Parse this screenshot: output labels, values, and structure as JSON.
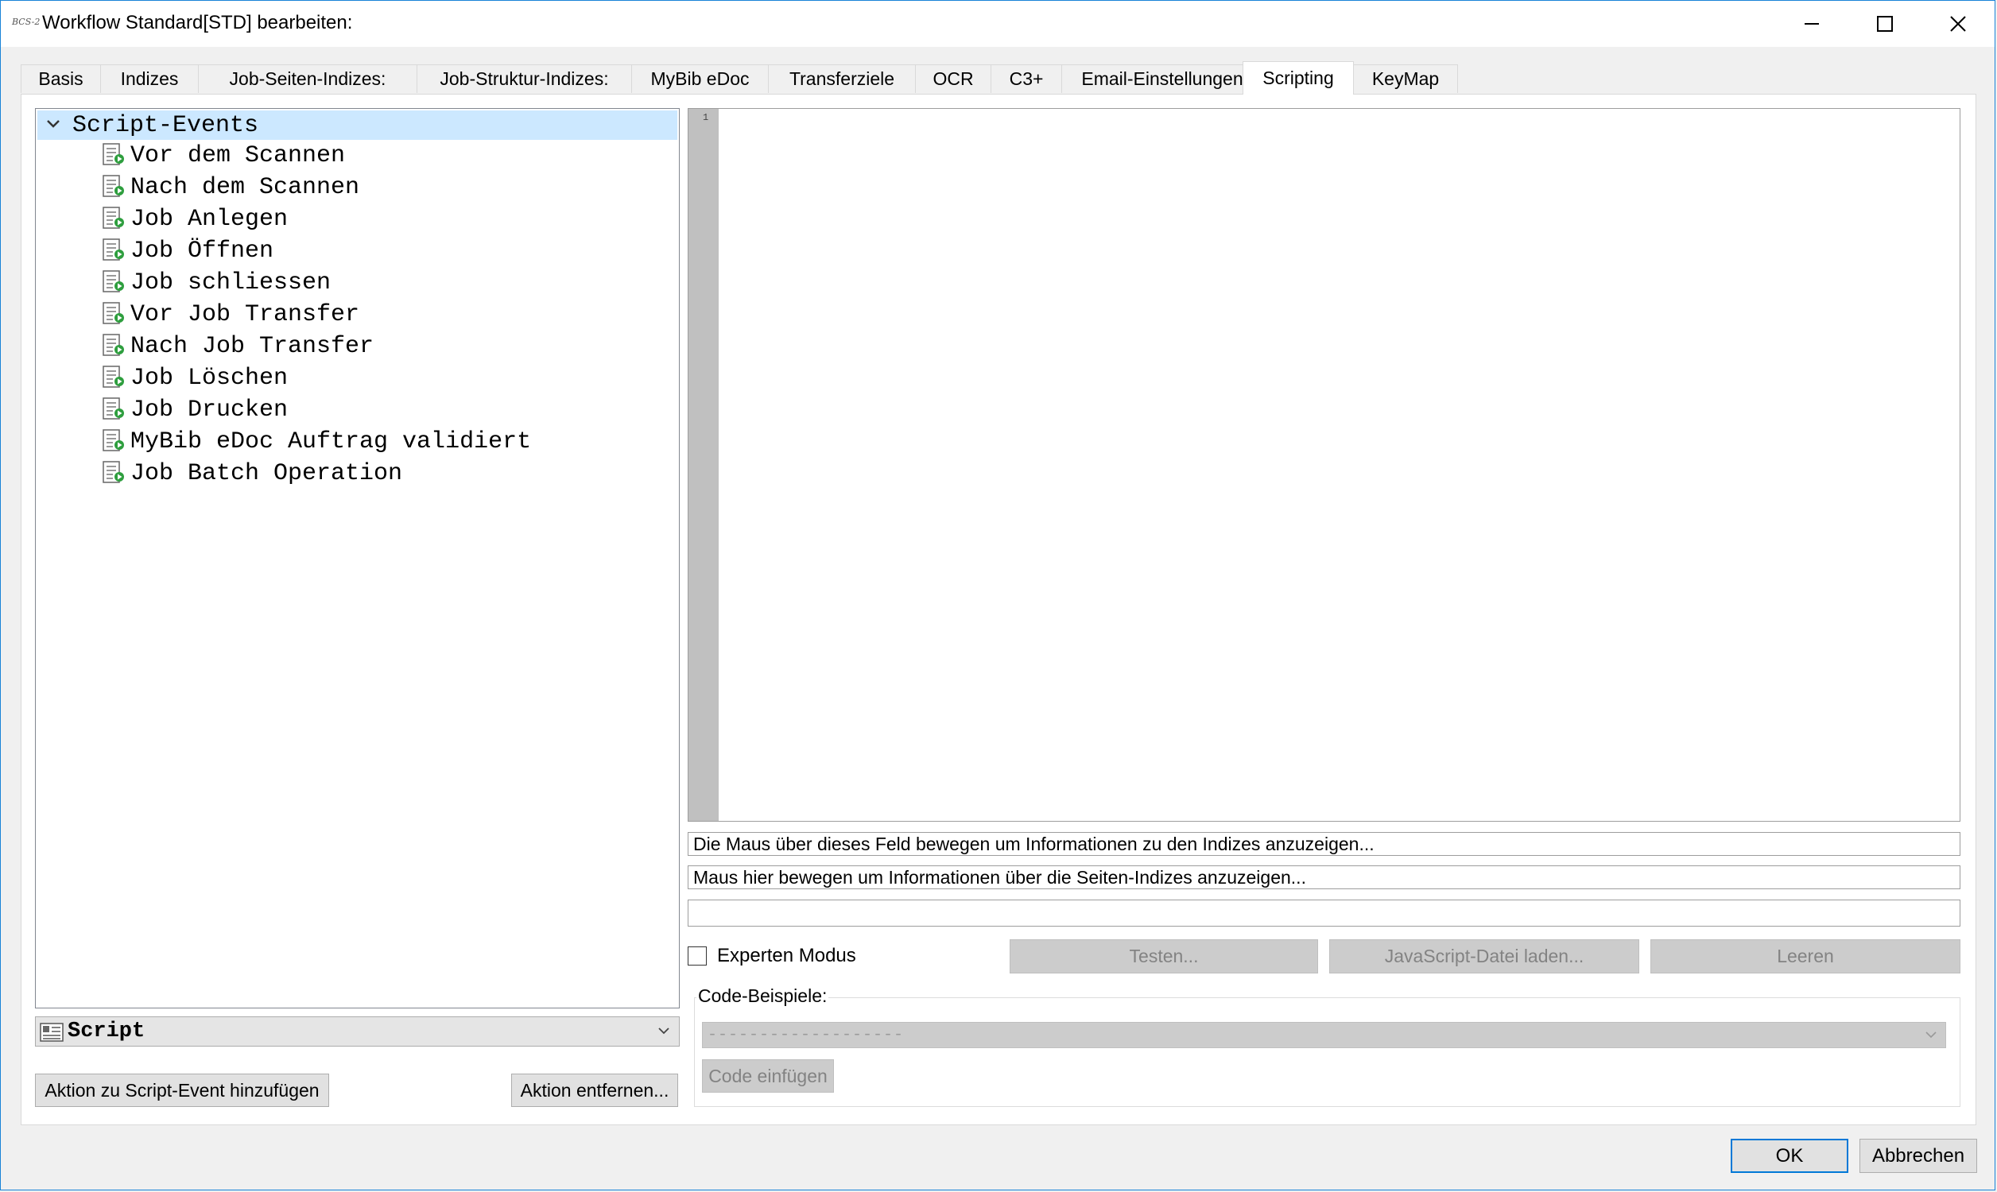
{
  "window": {
    "logo_text": "BCS-2",
    "title": "Workflow Standard[STD] bearbeiten:",
    "minimize_icon": "minimize-icon",
    "maximize_icon": "maximize-icon",
    "close_icon": "close-icon"
  },
  "tabs": [
    {
      "label": "Basis",
      "active": false
    },
    {
      "label": "Indizes",
      "active": false
    },
    {
      "label": "Job-Seiten-Indizes:",
      "active": false
    },
    {
      "label": "Job-Struktur-Indizes:",
      "active": false
    },
    {
      "label": "MyBib eDoc",
      "active": false
    },
    {
      "label": "Transferziele",
      "active": false
    },
    {
      "label": "OCR",
      "active": false
    },
    {
      "label": "C3+",
      "active": false
    },
    {
      "label": "Email-Einstellungen",
      "active": false
    },
    {
      "label": "Scripting",
      "active": true
    },
    {
      "label": "KeyMap",
      "active": false
    }
  ],
  "tree": {
    "root_label": "Script-Events",
    "expanded": true,
    "items": [
      {
        "label": "Vor dem Scannen"
      },
      {
        "label": "Nach dem Scannen"
      },
      {
        "label": "Job Anlegen"
      },
      {
        "label": "Job Öffnen"
      },
      {
        "label": "Job schliessen"
      },
      {
        "label": "Vor Job Transfer"
      },
      {
        "label": "Nach Job Transfer"
      },
      {
        "label": "Job Löschen"
      },
      {
        "label": "Job Drucken"
      },
      {
        "label": "MyBib eDoc Auftrag validiert"
      },
      {
        "label": "Job Batch Operation"
      }
    ]
  },
  "action_type": {
    "selected": "Script"
  },
  "buttons": {
    "add_action": "Aktion zu Script-Event hinzufügen",
    "remove_action": "Aktion entfernen...",
    "test": "Testen...",
    "load_js": "JavaScript-Datei laden...",
    "clear": "Leeren",
    "insert_code": "Code einfügen",
    "ok": "OK",
    "cancel": "Abbrechen"
  },
  "editor": {
    "line_numbers": [
      "1"
    ],
    "content": ""
  },
  "info": {
    "indices_hint": "Die Maus über dieses Feld bewegen um Informationen zu den Indizes anzuzeigen...",
    "page_indices_hint": "Maus hier bewegen um Informationen über die Seiten-Indizes anzuzeigen...",
    "third_field": ""
  },
  "expert_mode": {
    "label": "Experten Modus",
    "checked": false
  },
  "code_examples": {
    "label": "Code-Beispiele:",
    "selected": "-------------------"
  },
  "colors": {
    "window_border": "#1883d7",
    "tree_selection": "#cce8ff",
    "primary_button_border": "#0078d7",
    "icon_green": "#2e9e3e"
  }
}
